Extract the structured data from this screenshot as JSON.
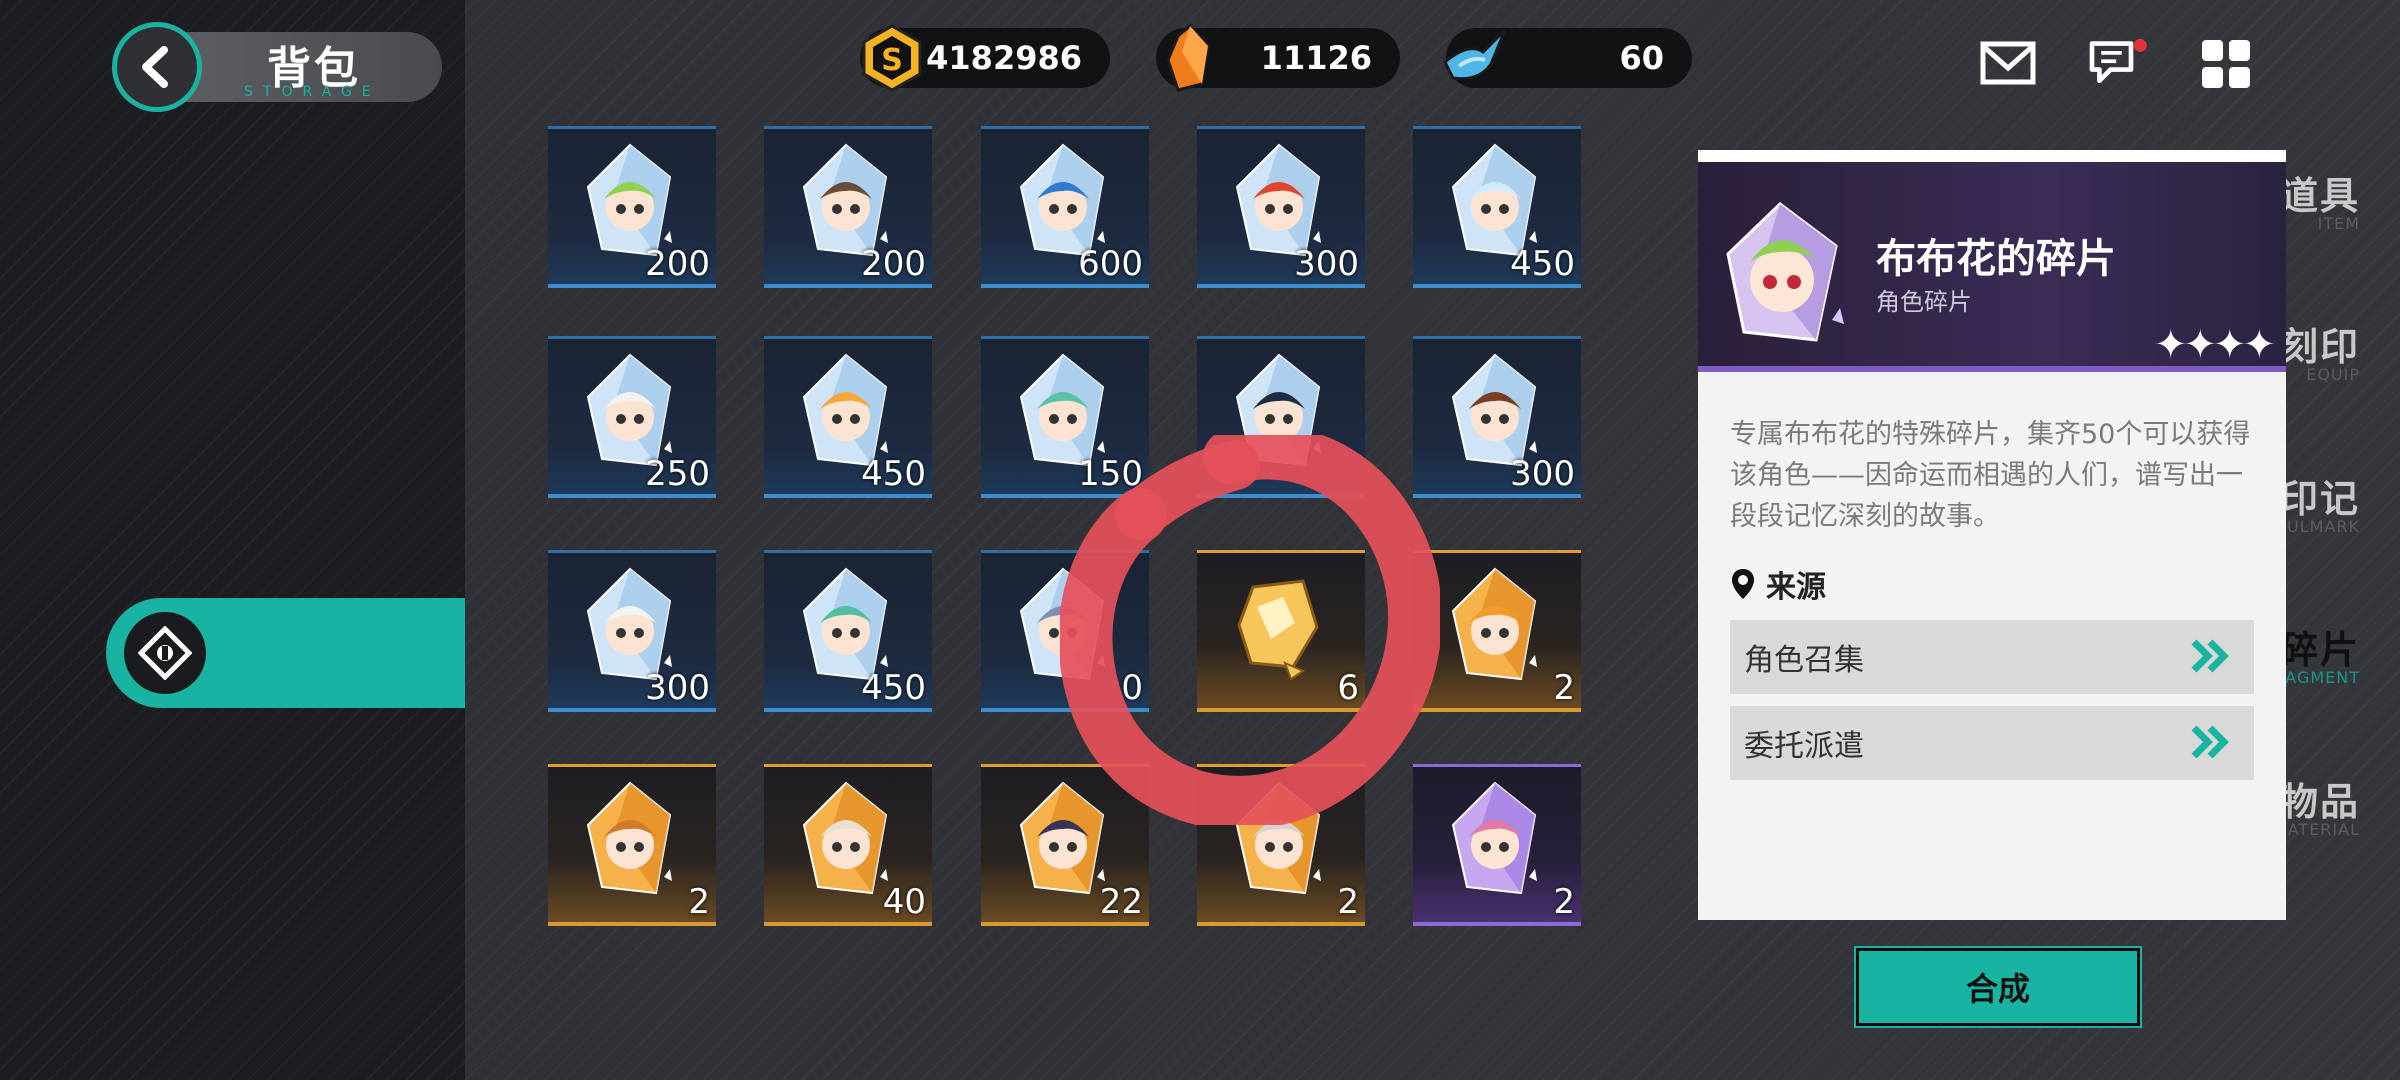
{
  "header": {
    "title": "背包",
    "subtitle": "STORAGE"
  },
  "currencies": [
    {
      "icon": "coin-icon",
      "value": "4182986",
      "color": "#f5b324"
    },
    {
      "icon": "crystal-icon",
      "value": "11126",
      "color": "#f07d1c"
    },
    {
      "icon": "stamina-icon",
      "value": "60",
      "color": "#4fb6e8"
    }
  ],
  "top_icons": [
    "mail-icon",
    "chat-icon",
    "menu-grid-icon"
  ],
  "sidebar": {
    "items": [
      {
        "label": "道具",
        "en": "ITEM"
      },
      {
        "label": "刻印",
        "en": "EQUIP"
      },
      {
        "label": "角色印记",
        "en": "SOULMARK"
      },
      {
        "label": "角色碎片",
        "en": "FRAGMENT",
        "active": true
      },
      {
        "label": "消耗物品",
        "en": "MATERIAL"
      }
    ]
  },
  "grid": [
    {
      "count": "200",
      "rarity": "blue"
    },
    {
      "count": "200",
      "rarity": "blue"
    },
    {
      "count": "600",
      "rarity": "blue"
    },
    {
      "count": "300",
      "rarity": "blue"
    },
    {
      "count": "450",
      "rarity": "blue"
    },
    {
      "count": "250",
      "rarity": "blue"
    },
    {
      "count": "450",
      "rarity": "blue"
    },
    {
      "count": "150",
      "rarity": "blue"
    },
    {
      "count": "",
      "rarity": "blue"
    },
    {
      "count": "300",
      "rarity": "blue"
    },
    {
      "count": "300",
      "rarity": "blue"
    },
    {
      "count": "450",
      "rarity": "blue"
    },
    {
      "count": "0",
      "rarity": "blue"
    },
    {
      "count": "6",
      "rarity": "gold"
    },
    {
      "count": "2",
      "rarity": "gold"
    },
    {
      "count": "2",
      "rarity": "gold"
    },
    {
      "count": "40",
      "rarity": "gold"
    },
    {
      "count": "22",
      "rarity": "gold"
    },
    {
      "count": "2",
      "rarity": "gold"
    },
    {
      "count": "2",
      "rarity": "purple"
    }
  ],
  "detail": {
    "name": "布布花的碎片",
    "type": "角色碎片",
    "stars": "✦✦✦✦",
    "description": "专属布布花的特殊碎片，集齐50个可以获得该角色——因命运而相遇的人们，谱写出一段段记忆深刻的故事。",
    "source_label": "来源",
    "sources": [
      "角色召集",
      "委托派遣"
    ],
    "craft_label": "合成"
  },
  "colors": {
    "accent": "#19b3a2",
    "annotation": "#e5505a"
  }
}
